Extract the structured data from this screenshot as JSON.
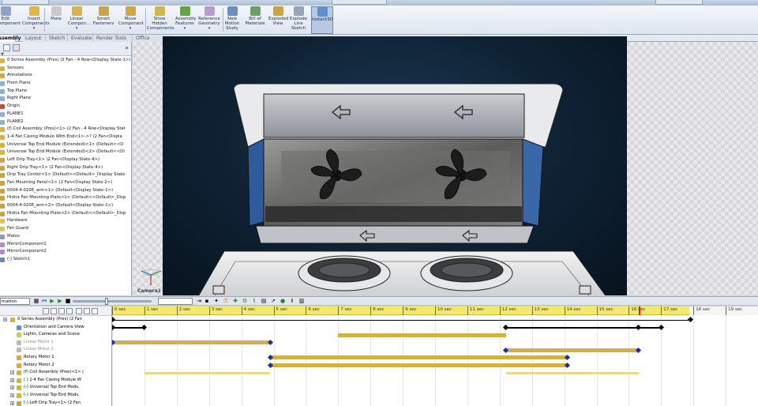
{
  "titlebar": {
    "left_tab": "",
    "mid_tab": "",
    "right_tab": ""
  },
  "ribbon": {
    "buttons": [
      {
        "label": "Edit\nComponent",
        "color": "#8fa4c4"
      },
      {
        "label": "Insert\nComponents",
        "color": "#e0b84a"
      },
      {
        "label": "Mate",
        "color": "#c9c9c9"
      },
      {
        "label": "Linear\nCompon...",
        "color": "#d9b44a"
      },
      {
        "label": "Smart\nFasteners",
        "color": "#c7a54c"
      },
      {
        "label": "Move\nComponent",
        "color": "#c9a84a"
      },
      {
        "label": "Show\nHidden\nComponents",
        "color": "#cfb552"
      },
      {
        "label": "Assembly\nFeatures",
        "color": "#65a34a"
      },
      {
        "label": "Reference\nGeometry",
        "color": "#b59bd0"
      },
      {
        "label": "New\nMotion\nStudy",
        "color": "#6c8fbf"
      },
      {
        "label": "Bill of\nMaterials",
        "color": "#6b9f64"
      },
      {
        "label": "Exploded\nView",
        "color": "#c9a548"
      },
      {
        "label": "Explode\nLine\nSketch",
        "color": "#9aa5b3"
      },
      {
        "label": "Instant3D",
        "color": "#5e90c8"
      }
    ]
  },
  "tabs": [
    "Assembly",
    "Layout",
    "Sketch",
    "Evaluate",
    "Render Tools",
    "Office Products"
  ],
  "feature_tree": {
    "items": [
      {
        "label": "0 Series Assembly (Pres) (2 Fan - 4 Row<Display State-1>)",
        "icon": "assembly-icon",
        "color": "#d5b23c"
      },
      {
        "label": "Sensors",
        "icon": "sensor-icon",
        "color": "#d6b141"
      },
      {
        "label": "Annotations",
        "icon": "annotation-icon",
        "color": "#d2a93c"
      },
      {
        "label": "Front Plane",
        "icon": "plane-icon",
        "color": "#8cb0d8"
      },
      {
        "label": "Top Plane",
        "icon": "plane-icon",
        "color": "#8cb0d8"
      },
      {
        "label": "Right Plane",
        "icon": "plane-icon",
        "color": "#8cb0d8"
      },
      {
        "label": "Origin",
        "icon": "origin-icon",
        "color": "#c24a3a"
      },
      {
        "label": "PLANE1",
        "icon": "plane-icon",
        "color": "#8cb0d8"
      },
      {
        "label": "PLANE2",
        "icon": "plane-icon",
        "color": "#8cb0d8"
      },
      {
        "label": "(f) Coil Assembly (Pres)<1> (2 Fan - 4 Row<Display Stat",
        "icon": "assembly-icon",
        "color": "#d5b23c"
      },
      {
        "label": "1-4 Fan Casing Module With End<1>->? (2 Fan<Displa",
        "icon": "assembly-icon",
        "color": "#d5b23c"
      },
      {
        "label": "Universal Top End Module (Extended)<1> (Default<<D",
        "icon": "assembly-icon",
        "color": "#d5b23c"
      },
      {
        "label": "Universal Top End Module (Extended)<2> (Default<<Di",
        "icon": "assembly-icon",
        "color": "#d5b23c"
      },
      {
        "label": "Left Drip Tray<1> (2 Fan<Display State-4>)",
        "icon": "part-icon",
        "color": "#c9a33c"
      },
      {
        "label": "Right Drip Tray<1> (2 Fan<Display State-4>)",
        "icon": "part-icon",
        "color": "#c9a33c"
      },
      {
        "label": "Drip Tray Center<1> (Default<<Default>_Display State",
        "icon": "part-icon",
        "color": "#c9a33c"
      },
      {
        "label": "Fan Mounting Panel<1> (2 Fan<Display State-2>)",
        "icon": "part-icon",
        "color": "#c9a33c"
      },
      {
        "label": "0004-4-0206_arm<1> (Default<Display State-1>)",
        "icon": "part-icon",
        "color": "#c9a33c"
      },
      {
        "label": "Hidria Fan Mounting Plate<1> (Default<<Default>_Disp",
        "icon": "part-icon",
        "color": "#c9a33c"
      },
      {
        "label": "0004-4-0206_arm<2> (Default<Display State-1>)",
        "icon": "part-icon",
        "color": "#c9a33c"
      },
      {
        "label": "Hidria Fan Mounting Plate<2> (Default<<Default>_Disp",
        "icon": "part-icon",
        "color": "#c9a33c"
      },
      {
        "label": "Hardware",
        "icon": "folder-icon",
        "color": "#e0c25a"
      },
      {
        "label": "Fan Guard",
        "icon": "folder-icon",
        "color": "#e0c25a"
      },
      {
        "label": "Mates",
        "icon": "mates-icon",
        "color": "#8b9bb0"
      },
      {
        "label": "MirrorComponent1",
        "icon": "mirror-icon",
        "color": "#b48ac9"
      },
      {
        "label": "MirrorComponent2",
        "icon": "mirror-icon",
        "color": "#b48ac9"
      },
      {
        "label": "(-) Sketch1",
        "icon": "sketch-icon",
        "color": "#6a8ab3"
      }
    ]
  },
  "viewport": {
    "camera_label": "Camera1"
  },
  "motion_toolbar": {
    "study_type": "mation"
  },
  "motion_tree": {
    "items": [
      {
        "label": "0 Series Assembly (Pres) (2 Fan",
        "icon_color": "#d5b23c",
        "dim": false
      },
      {
        "label": "Orientation and Camera View",
        "icon_color": "#5e90c8",
        "dim": false
      },
      {
        "label": "Lights, Cameras and Scene",
        "icon_color": "#e2c24a",
        "dim": false
      },
      {
        "label": "Linear Motor 1",
        "icon_color": "#b9b9b9",
        "dim": true
      },
      {
        "label": "Linear Motor 2",
        "icon_color": "#b9b9b9",
        "dim": true
      },
      {
        "label": "Rotary Motor 1",
        "icon_color": "#d9a93a",
        "dim": false
      },
      {
        "label": "Rotary Motor 2",
        "icon_color": "#d9a93a",
        "dim": false
      },
      {
        "label": "(f) Coil Assembly (Pres)<1> (",
        "icon_color": "#d5b23c",
        "dim": false
      },
      {
        "label": "( ) 1-4 Fan Casing Module W",
        "icon_color": "#d5b23c",
        "dim": false
      },
      {
        "label": "(-) Universal Top End Modu",
        "icon_color": "#d5b23c",
        "dim": false
      },
      {
        "label": "(-) Universal Top End Modu",
        "icon_color": "#d5b23c",
        "dim": false
      },
      {
        "label": "(-) Left Drip Tray<1> (2 Fan",
        "icon_color": "#c9a33c",
        "dim": false
      }
    ]
  },
  "timeline": {
    "seconds_labels": [
      "0 sec",
      "1 sec",
      "2 sec",
      "3 sec",
      "4 sec",
      "5 sec",
      "6 sec",
      "7 sec",
      "8 sec",
      "9 sec",
      "10 sec",
      "11 sec",
      "12 sec",
      "13 sec",
      "14 sec",
      "15 sec",
      "16 sec",
      "17 sec",
      "18 sec",
      "19 sec",
      "20"
    ],
    "playhead_sec": 16.3,
    "end_sec": 17.9,
    "rows": [
      {
        "row": 0,
        "type": "line",
        "start": 0,
        "end": 17.9,
        "color": "#000000",
        "keys": [
          0,
          17.9
        ]
      },
      {
        "row": 1,
        "type": "line",
        "start": 0,
        "end": 1.0,
        "color": "#000000",
        "keys": [
          0,
          1.0
        ]
      },
      {
        "row": 1,
        "type": "line",
        "start": 12.2,
        "end": 17.0,
        "color": "#000000",
        "keys": [
          12.2,
          16.3,
          17.0
        ]
      },
      {
        "row": 2,
        "type": "bar",
        "start": 7.0,
        "end": 12.2,
        "color": "#d4b04a",
        "keys": []
      },
      {
        "row": 3,
        "type": "bar",
        "start": 0,
        "end": 4.9,
        "color": "#d4b04a",
        "keys": [
          0,
          4.9
        ]
      },
      {
        "row": 4,
        "type": "bar",
        "start": 12.2,
        "end": 16.3,
        "color": "#d4b04a",
        "keys": [
          12.2,
          16.3
        ]
      },
      {
        "row": 5,
        "type": "bar",
        "start": 4.9,
        "end": 14.1,
        "color": "#d4b04a",
        "keys": [
          4.9,
          14.1
        ]
      },
      {
        "row": 6,
        "type": "bar",
        "start": 4.9,
        "end": 14.1,
        "color": "#d4b04a",
        "keys": [
          4.9,
          14.1
        ]
      },
      {
        "row": 7,
        "type": "thin",
        "start": 1.0,
        "end": 4.9,
        "color": "#f2e04a",
        "keys": []
      },
      {
        "row": 7,
        "type": "thin",
        "start": 12.2,
        "end": 16.3,
        "color": "#f2e04a",
        "keys": []
      }
    ]
  }
}
